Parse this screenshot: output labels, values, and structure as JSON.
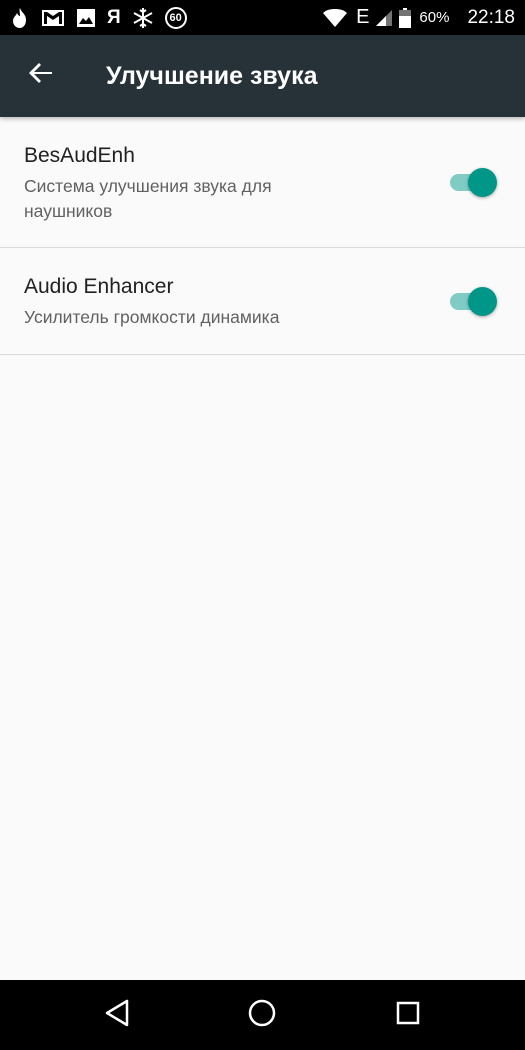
{
  "status_bar": {
    "notification_icons": [
      "tinder-flame-icon",
      "gmail-icon",
      "image-icon",
      "yandex-icon",
      "snowflake-icon",
      "speed-60-icon"
    ],
    "yandex_letter": "Я",
    "speed_badge": "60",
    "network_type": "E",
    "battery_percent": "60%",
    "time": "22:18"
  },
  "toolbar": {
    "back_icon": "arrow-back-icon",
    "title": "Улучшение звука",
    "background_color": "#263238"
  },
  "preferences": [
    {
      "title": "BesAudEnh",
      "summary": "Система улучшения звука для наушников",
      "enabled": true
    },
    {
      "title": "Audio Enhancer",
      "summary": "Усилитель громкости динамика",
      "enabled": true
    }
  ],
  "accent_color": "#009688",
  "navigation_bar": {
    "buttons": [
      "back-triangle-icon",
      "home-circle-icon",
      "recents-square-icon"
    ]
  }
}
